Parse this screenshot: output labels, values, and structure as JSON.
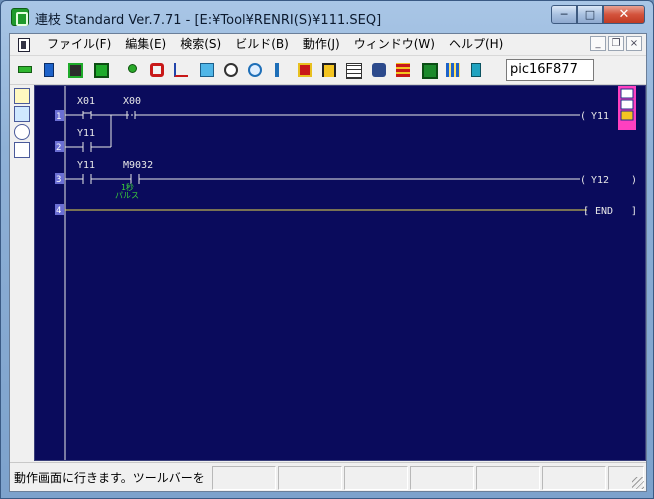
{
  "window": {
    "title": "連枝 Standard Ver.7.71 - [E:¥Tool¥RENRI(S)¥111.SEQ]"
  },
  "caption": {
    "minimize": "─",
    "maximize": "□",
    "close": "✕"
  },
  "menu": {
    "items": [
      "ファイル(F)",
      "編集(E)",
      "検索(S)",
      "ビルド(B)",
      "動作(J)",
      "ウィンドウ(W)",
      "ヘルプ(H)"
    ],
    "mdi": {
      "minimize": "_",
      "restore": "❐",
      "close": "×"
    }
  },
  "toolbar": {
    "cpu": "pic16F877",
    "icons": [
      "run-mode-icon",
      "monitor-icon",
      "online-icon",
      "offline-icon",
      "contact-icon",
      "coil-icon",
      "function-icon",
      "rising-edge-icon",
      "coil-set-icon",
      "timer-icon",
      "counter-icon",
      "vertical-line-icon",
      "stool-icon",
      "branch-icon",
      "grid-icon",
      "binoculars-icon",
      "stack-icon",
      "export-icon",
      "table-icon",
      "transfer-icon"
    ]
  },
  "ladder": {
    "rungs": [
      {
        "num": "1",
        "contacts": [
          "X01",
          "X00"
        ],
        "coil": "Y11"
      },
      {
        "num": "2",
        "contacts": [
          "Y11"
        ]
      },
      {
        "num": "3",
        "contacts": [
          "Y11",
          "M9032"
        ],
        "note_line1": "1秒",
        "note_line2": "パルス",
        "coil": "Y12"
      },
      {
        "num": "4",
        "end": "END"
      }
    ]
  },
  "status": {
    "message": "動作画面に行きます。ツールバーを"
  }
}
